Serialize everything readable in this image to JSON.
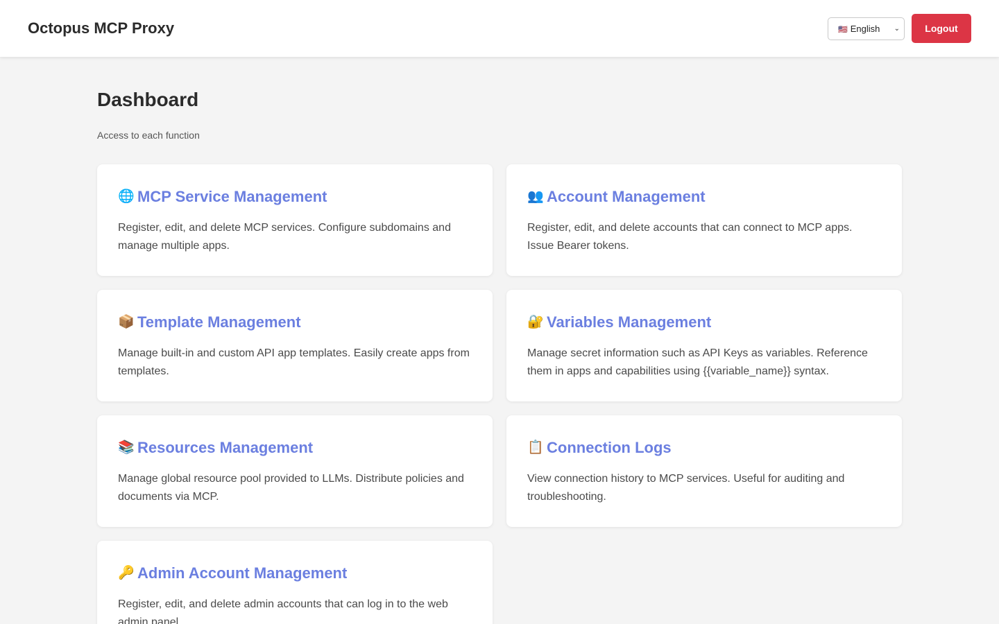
{
  "header": {
    "brand": "Octopus MCP Proxy",
    "language": {
      "flag": "🇺🇸",
      "selected": "English"
    },
    "logout_label": "Logout"
  },
  "page": {
    "title": "Dashboard",
    "subtitle": "Access to each function"
  },
  "cards": [
    {
      "icon": "🌐",
      "icon_name": "globe-icon",
      "title": "MCP Service Management",
      "description": "Register, edit, and delete MCP services. Configure subdomains and manage multiple apps."
    },
    {
      "icon": "👥",
      "icon_name": "users-icon",
      "title": "Account Management",
      "description": "Register, edit, and delete accounts that can connect to MCP apps. Issue Bearer tokens."
    },
    {
      "icon": "📦",
      "icon_name": "package-icon",
      "title": "Template Management",
      "description": "Manage built-in and custom API app templates. Easily create apps from templates."
    },
    {
      "icon": "🔐",
      "icon_name": "lock-key-icon",
      "title": "Variables Management",
      "description": "Manage secret information such as API Keys as variables. Reference them in apps and capabilities using {{variable_name}} syntax."
    },
    {
      "icon": "📚",
      "icon_name": "books-icon",
      "title": "Resources Management",
      "description": "Manage global resource pool provided to LLMs. Distribute policies and documents via MCP."
    },
    {
      "icon": "📋",
      "icon_name": "clipboard-icon",
      "title": "Connection Logs",
      "description": "View connection history to MCP services. Useful for auditing and troubleshooting."
    },
    {
      "icon": "🔑",
      "icon_name": "key-icon",
      "title": "Admin Account Management",
      "description": "Register, edit, and delete admin accounts that can log in to the web admin panel."
    }
  ],
  "colors": {
    "accent": "#6b7fe0",
    "danger": "#dc3545",
    "background": "#f4f4f4"
  }
}
